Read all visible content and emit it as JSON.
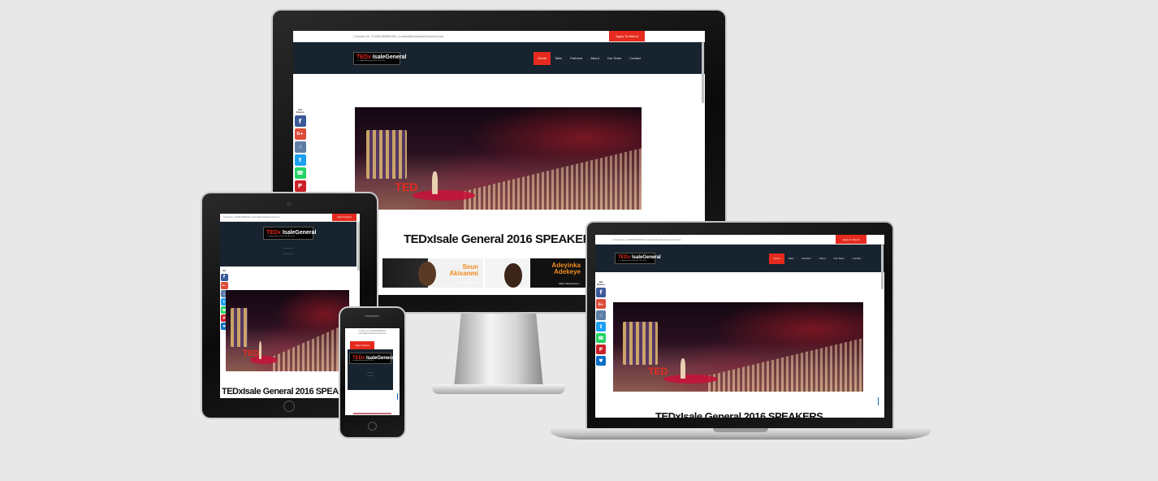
{
  "site": {
    "contact_desktop": "Contact Us +2348136356493  |  contact@tedxIsaleGeneral.com",
    "contact_tablet": "Contact Us +2348136356493  |  contact@tedxIsaleGeneral.com",
    "contact_phone_line1": "Contact Us +2348136356493  |",
    "contact_phone_line2": "contact@tedxIsaleGeneral.com",
    "apply_label": "Apply To Attend",
    "logo_ted": "TED",
    "logo_x": "x",
    "logo_name": "IsaleGeneral",
    "logo_tagline": "x = independently organized TED event",
    "nav": [
      "Home",
      "Talks",
      "Partners",
      "About",
      "Our Team",
      "Contact"
    ],
    "share_label_line1": "Ibd",
    "share_label_line2": "Shares",
    "page_title": "TEDxIsale General 2016 SPEAKERS",
    "page_title_tablet": "TEDxIsale General 2016 SPEAK",
    "page_title_desktop": "TEDxIsale General 2016 SPEAKER",
    "page_title_laptop_cut": "TEDxIsale General 2016 SPEAKERS"
  },
  "share_buttons": [
    {
      "icon": "facebook-icon",
      "glyph": "f",
      "color": "#3b5998"
    },
    {
      "icon": "google-plus-icon",
      "glyph": "G+",
      "color": "#dd4b39"
    },
    {
      "icon": "like-icon",
      "glyph": "☝",
      "color": "#5f7ea6"
    },
    {
      "icon": "twitter-icon",
      "glyph": "t",
      "color": "#1da1f2"
    },
    {
      "icon": "whatsapp-icon",
      "glyph": "☎",
      "color": "#25d366"
    },
    {
      "icon": "pinterest-icon",
      "glyph": "P",
      "color": "#cb2027"
    },
    {
      "icon": "bookmark-icon",
      "glyph": "♥",
      "color": "#0a6ec7"
    }
  ],
  "speakers": [
    {
      "name_line1": "Seun",
      "name_line2": "Akisanmi",
      "title": "CEO, Blogvolution"
    },
    {
      "name_line1": "Adeyinka",
      "name_line2": "Adekeye",
      "title": "CEO, Recruitment..."
    }
  ],
  "colors": {
    "accent": "#e62b1e",
    "navbar": "#17232e",
    "background": "#e8e8e8"
  }
}
